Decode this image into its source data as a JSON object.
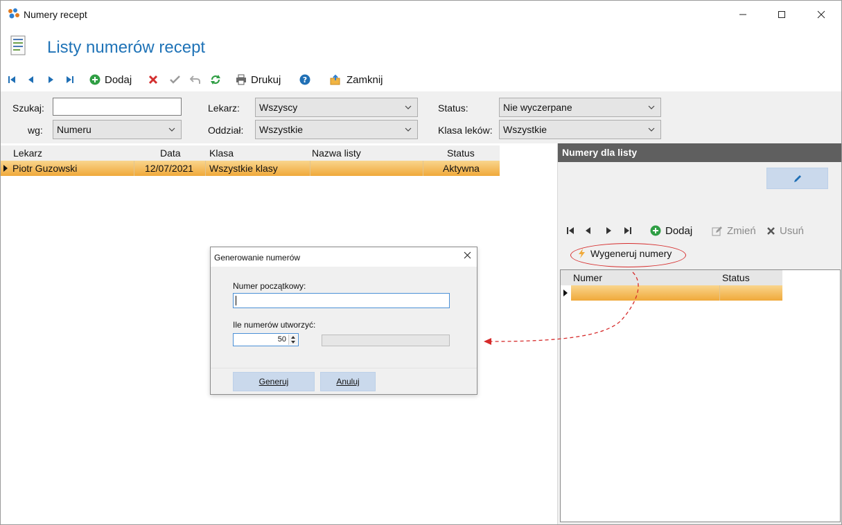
{
  "window": {
    "title": "Numery recept"
  },
  "page": {
    "title": "Listy numerów recept"
  },
  "toolbar": {
    "add_label": "Dodaj",
    "print_label": "Drukuj",
    "close_label": "Zamknij"
  },
  "filters": {
    "search_label": "Szukaj:",
    "search_value": "",
    "by_label": "wg:",
    "by_value": "Numeru",
    "doctor_label": "Lekarz:",
    "doctor_value": "Wszyscy",
    "department_label": "Oddział:",
    "department_value": "Wszystkie",
    "status_label": "Status:",
    "status_value": "Nie wyczerpane",
    "drug_class_label": "Klasa leków:",
    "drug_class_value": "Wszystkie"
  },
  "grid": {
    "columns": [
      "Lekarz",
      "Data",
      "Klasa",
      "Nazwa listy",
      "Status"
    ],
    "rows": [
      {
        "doctor": "Piotr Guzowski",
        "date": "12/07/2021",
        "class": "Wszystkie klasy",
        "name": "",
        "status": "Aktywna"
      }
    ]
  },
  "right_panel": {
    "title": "Numery dla listy",
    "add_label": "Dodaj",
    "change_label": "Zmień",
    "delete_label": "Usuń",
    "generate_label": "Wygeneruj numery",
    "columns": [
      "Numer",
      "Status"
    ]
  },
  "dialog": {
    "title": "Generowanie numerów",
    "start_label": "Numer początkowy:",
    "start_value": "",
    "count_label": "Ile numerów utworzyć:",
    "count_value": "50",
    "generate_button": "Generuj",
    "cancel_button": "Anuluj"
  },
  "colors": {
    "title_blue": "#1f73b7",
    "selected_row": "#f0a93a",
    "panel_header": "#5f5f5f",
    "button_bg": "#cad9ec",
    "annotation_red": "#d62b2b",
    "nav_blue": "#1f6fb5",
    "add_green": "#2f9e44"
  }
}
